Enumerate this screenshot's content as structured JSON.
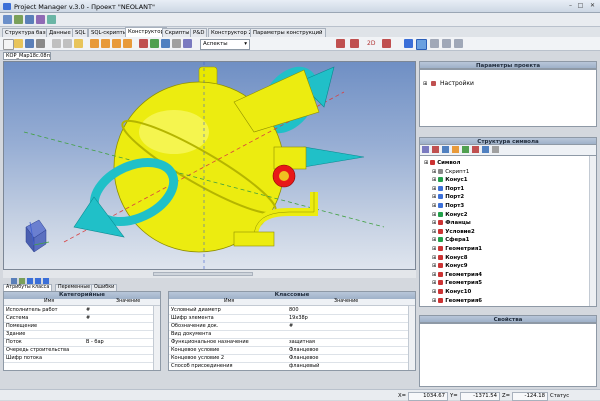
{
  "window": {
    "title": "Project Manager v.3.0 - Проект \"NEOLANT\"",
    "minimize": "–",
    "maximize": "□",
    "close": "✕"
  },
  "main_tabs": [
    "Структура базы",
    "Данные",
    "SQL",
    "SQL-скрипты",
    "Конструктор",
    "Скрипты",
    "P&D",
    "Конструктор 2D",
    "Параметры конструкций"
  ],
  "active_tab": "Конструктор",
  "toolbar": {
    "view_combo_value": "Аспекты",
    "mode_label": "2D"
  },
  "document_tab": "КОР_Мар18с.08п",
  "lower": {
    "tabs": [
      "Атрибуты класса",
      "Переменные",
      "Ошибки"
    ],
    "category_panel": {
      "title": "Категорийные",
      "col_name": "Имя",
      "col_value": "Значение",
      "rows": [
        {
          "k": "Исполнитель работ",
          "v": "#"
        },
        {
          "k": "Система",
          "v": "#"
        },
        {
          "k": "Помещение",
          "v": ""
        },
        {
          "k": "Здание",
          "v": ""
        },
        {
          "k": "Поток",
          "v": "В - бар"
        },
        {
          "k": "Очередь строительства",
          "v": ""
        },
        {
          "k": "Шифр потока",
          "v": ""
        }
      ]
    },
    "class_panel": {
      "title": "Классовые",
      "col_name": "Имя",
      "col_value": "Значение",
      "rows": [
        {
          "k": "Условный диаметр",
          "v": "800"
        },
        {
          "k": "Шифр элемента",
          "v": "19х38р"
        },
        {
          "k": "Обозначение док.",
          "v": "#"
        },
        {
          "k": "Вид документа",
          "v": ""
        },
        {
          "k": "Функциональное назначение",
          "v": "защитная"
        },
        {
          "k": "Концевое условие",
          "v": "Фланцевое"
        },
        {
          "k": "Концевое условие 2",
          "v": "Фланцевое"
        },
        {
          "k": "Способ присоединения",
          "v": "фланцевый"
        }
      ]
    }
  },
  "right": {
    "project_params_title": "Параметры проекта",
    "settings_node": "Настройки",
    "symbol_struct_title": "Структура символа",
    "properties_title": "Свойства",
    "tree": [
      {
        "label": "Символ",
        "bold": true,
        "depth": 0,
        "color": "#cc3333"
      },
      {
        "label": "Скрипт1",
        "bold": false,
        "depth": 1,
        "color": "#888888"
      },
      {
        "label": "Конус1",
        "bold": true,
        "depth": 1,
        "color": "#22a04a"
      },
      {
        "label": "Порт1",
        "bold": true,
        "depth": 1,
        "color": "#3b6fd8"
      },
      {
        "label": "Порт2",
        "bold": true,
        "depth": 1,
        "color": "#3b6fd8"
      },
      {
        "label": "Порт3",
        "bold": true,
        "depth": 1,
        "color": "#3b6fd8"
      },
      {
        "label": "Конус2",
        "bold": true,
        "depth": 1,
        "color": "#22a04a"
      },
      {
        "label": "Фланцы",
        "bold": true,
        "depth": 1,
        "color": "#cc3333"
      },
      {
        "label": "Условие2",
        "bold": true,
        "depth": 1,
        "color": "#cc3333"
      },
      {
        "label": "Сфера1",
        "bold": true,
        "depth": 1,
        "color": "#22a04a"
      },
      {
        "label": "Геометрия1",
        "bold": true,
        "depth": 1,
        "color": "#cc3333"
      },
      {
        "label": "Конус8",
        "bold": true,
        "depth": 1,
        "color": "#cc3333"
      },
      {
        "label": "Конус9",
        "bold": true,
        "depth": 1,
        "color": "#cc3333"
      },
      {
        "label": "Геометрия4",
        "bold": true,
        "depth": 1,
        "color": "#cc3333"
      },
      {
        "label": "Геометрия5",
        "bold": true,
        "depth": 1,
        "color": "#cc3333"
      },
      {
        "label": "Конус10",
        "bold": true,
        "depth": 1,
        "color": "#cc3333"
      },
      {
        "label": "Геометрия6",
        "bold": true,
        "depth": 1,
        "color": "#cc3333"
      }
    ]
  },
  "status": {
    "x_label": "X=",
    "x_value": "1034.67",
    "y_label": "Y=",
    "y_value": "-1371.54",
    "z_label": "Z=",
    "z_value": "-124.18",
    "state_label": "Статус"
  }
}
